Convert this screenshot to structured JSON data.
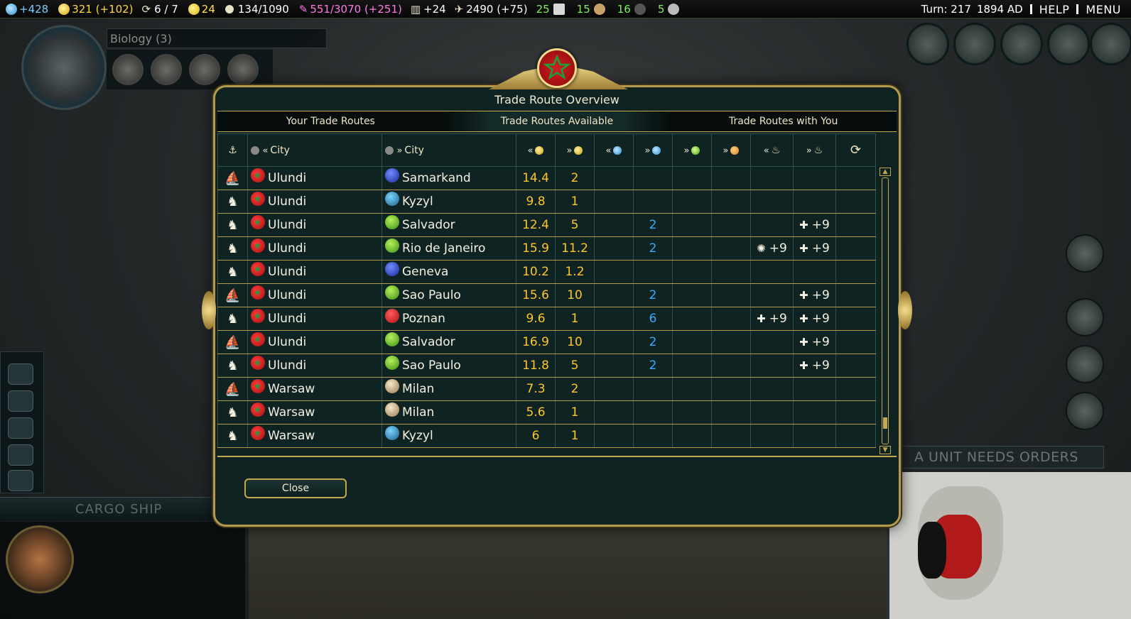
{
  "topbar": {
    "science": "+428",
    "gold": "321 (+102)",
    "trade_routes": "6 / 7",
    "happiness": "24",
    "golden_age": "134/1090",
    "culture": "551/3070 (+251)",
    "tourism": "+24",
    "faith": "2490 (+75)",
    "res1": "25",
    "res2": "15",
    "res3": "16",
    "res4": "5",
    "turn": "Turn: 217",
    "year": "1894 AD",
    "help": "HELP",
    "menu": "MENU"
  },
  "hud": {
    "tech_name": "Biology (3)",
    "unit_name": "CARGO SHIP",
    "notification": "A UNIT NEEDS ORDERS"
  },
  "dialog": {
    "title": "Trade Route Overview",
    "tabs": [
      "Your Trade Routes",
      "Trade Routes Available",
      "Trade Routes with You"
    ],
    "active_tab": 1,
    "headers": {
      "from_city": "City",
      "to_city": "City"
    },
    "close_label": "Close",
    "rows": [
      {
        "type": "ship",
        "from": "Ulundi",
        "to": "Samarkand",
        "to_civ": "blue",
        "gold_out": "14.4",
        "gold_in": "2",
        "sci_out": "",
        "sci_in": "",
        "food": "",
        "prod": "",
        "rel_out": "",
        "rel_in": ""
      },
      {
        "type": "camel",
        "from": "Ulundi",
        "to": "Kyzyl",
        "to_civ": "teal",
        "gold_out": "9.8",
        "gold_in": "1",
        "sci_out": "",
        "sci_in": "",
        "food": "",
        "prod": "",
        "rel_out": "",
        "rel_in": ""
      },
      {
        "type": "camel",
        "from": "Ulundi",
        "to": "Salvador",
        "to_civ": "green",
        "gold_out": "12.4",
        "gold_in": "5",
        "sci_out": "",
        "sci_in": "2",
        "food": "",
        "prod": "",
        "rel_out": "",
        "rel_in": "+9"
      },
      {
        "type": "camel",
        "from": "Ulundi",
        "to": "Rio de Janeiro",
        "to_civ": "green",
        "gold_out": "15.9",
        "gold_in": "11.2",
        "sci_out": "",
        "sci_in": "2",
        "food": "",
        "prod": "",
        "rel_out": "+9",
        "rel_in": "+9"
      },
      {
        "type": "camel",
        "from": "Ulundi",
        "to": "Geneva",
        "to_civ": "blue",
        "gold_out": "10.2",
        "gold_in": "1.2",
        "sci_out": "",
        "sci_in": "",
        "food": "",
        "prod": "",
        "rel_out": "",
        "rel_in": ""
      },
      {
        "type": "ship",
        "from": "Ulundi",
        "to": "Sao Paulo",
        "to_civ": "green",
        "gold_out": "15.6",
        "gold_in": "10",
        "sci_out": "",
        "sci_in": "2",
        "food": "",
        "prod": "",
        "rel_out": "",
        "rel_in": "+9"
      },
      {
        "type": "camel",
        "from": "Ulundi",
        "to": "Poznan",
        "to_civ": "red",
        "gold_out": "9.6",
        "gold_in": "1",
        "sci_out": "",
        "sci_in": "6",
        "food": "",
        "prod": "",
        "rel_out": "+9",
        "rel_in": "+9"
      },
      {
        "type": "ship",
        "from": "Ulundi",
        "to": "Salvador",
        "to_civ": "green",
        "gold_out": "16.9",
        "gold_in": "10",
        "sci_out": "",
        "sci_in": "2",
        "food": "",
        "prod": "",
        "rel_out": "",
        "rel_in": "+9"
      },
      {
        "type": "camel",
        "from": "Ulundi",
        "to": "Sao Paulo",
        "to_civ": "green",
        "gold_out": "11.8",
        "gold_in": "5",
        "sci_out": "",
        "sci_in": "2",
        "food": "",
        "prod": "",
        "rel_out": "",
        "rel_in": "+9"
      },
      {
        "type": "ship",
        "from": "Warsaw",
        "to": "Milan",
        "to_civ": "tan",
        "gold_out": "7.3",
        "gold_in": "2",
        "sci_out": "",
        "sci_in": "",
        "food": "",
        "prod": "",
        "rel_out": "",
        "rel_in": ""
      },
      {
        "type": "camel",
        "from": "Warsaw",
        "to": "Milan",
        "to_civ": "tan",
        "gold_out": "5.6",
        "gold_in": "1",
        "sci_out": "",
        "sci_in": "",
        "food": "",
        "prod": "",
        "rel_out": "",
        "rel_in": ""
      },
      {
        "type": "camel",
        "from": "Warsaw",
        "to": "Kyzyl",
        "to_civ": "teal",
        "gold_out": "6",
        "gold_in": "1",
        "sci_out": "",
        "sci_in": "",
        "food": "",
        "prod": "",
        "rel_out": "",
        "rel_in": ""
      }
    ]
  },
  "colors": {
    "gold_text": "#ffc62b",
    "science_text": "#3aa9ff",
    "frame_gold": "#c5a74f",
    "panel_bg": "#0f2422"
  }
}
